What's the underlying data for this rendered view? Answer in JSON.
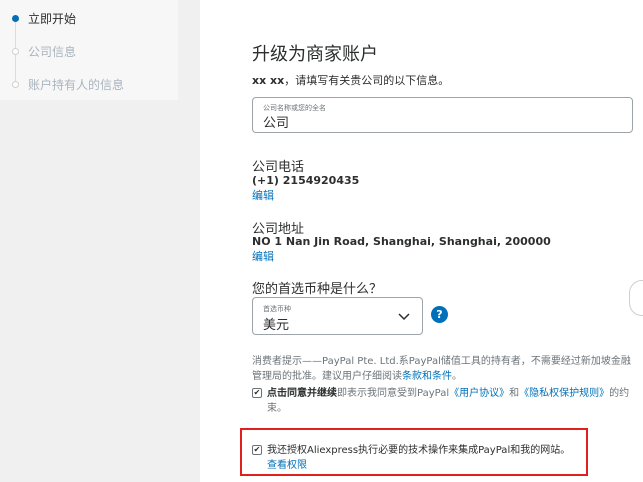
{
  "sidebar": {
    "steps": [
      {
        "label": "立即开始",
        "state": "active"
      },
      {
        "label": "公司信息",
        "state": "inactive"
      },
      {
        "label": "账户持有人的信息",
        "state": "inactive"
      }
    ]
  },
  "form": {
    "title": "升级为商家账户",
    "subtitle_name": "xx xx",
    "subtitle_rest": "，请填写有关贵公司的以下信息。",
    "company_name": {
      "placeholder": "公司名称或您的全名",
      "value": "公司"
    },
    "phone": {
      "label": "公司电话",
      "value": "(+1) 2154920435",
      "edit": "编辑"
    },
    "address": {
      "label": "公司地址",
      "value": "NO 1 Nan Jin Road, Shanghai, Shanghai, 200000",
      "edit": "编辑"
    },
    "currency": {
      "question": "您的首选币种是什么？",
      "placeholder": "首选币种",
      "value": "美元",
      "help": "?"
    },
    "notice": {
      "text_1": "消费者提示——PayPal Pte. Ltd.系PayPal储值工具的持有者，不需要经过新加坡金融管理局的批准。建议用户仔细阅读",
      "link": "条款和条件",
      "text_2": "。"
    },
    "agree": {
      "checkmark": "✔",
      "bold": "点击同意并继续",
      "text_1": "即表示我同意受到PayPal",
      "link_1": "《用户协议》",
      "text_2": "和",
      "link_2": "《隐私权保护规则》",
      "text_3": "的约束。"
    },
    "authorize": {
      "checkmark": "✔",
      "text": "我还授权Aliexpress执行必要的技术操作来集成PayPal和我的网站。",
      "link": "查看权限"
    }
  },
  "colors": {
    "accent": "#0070ba",
    "highlight": "#e0201c"
  }
}
